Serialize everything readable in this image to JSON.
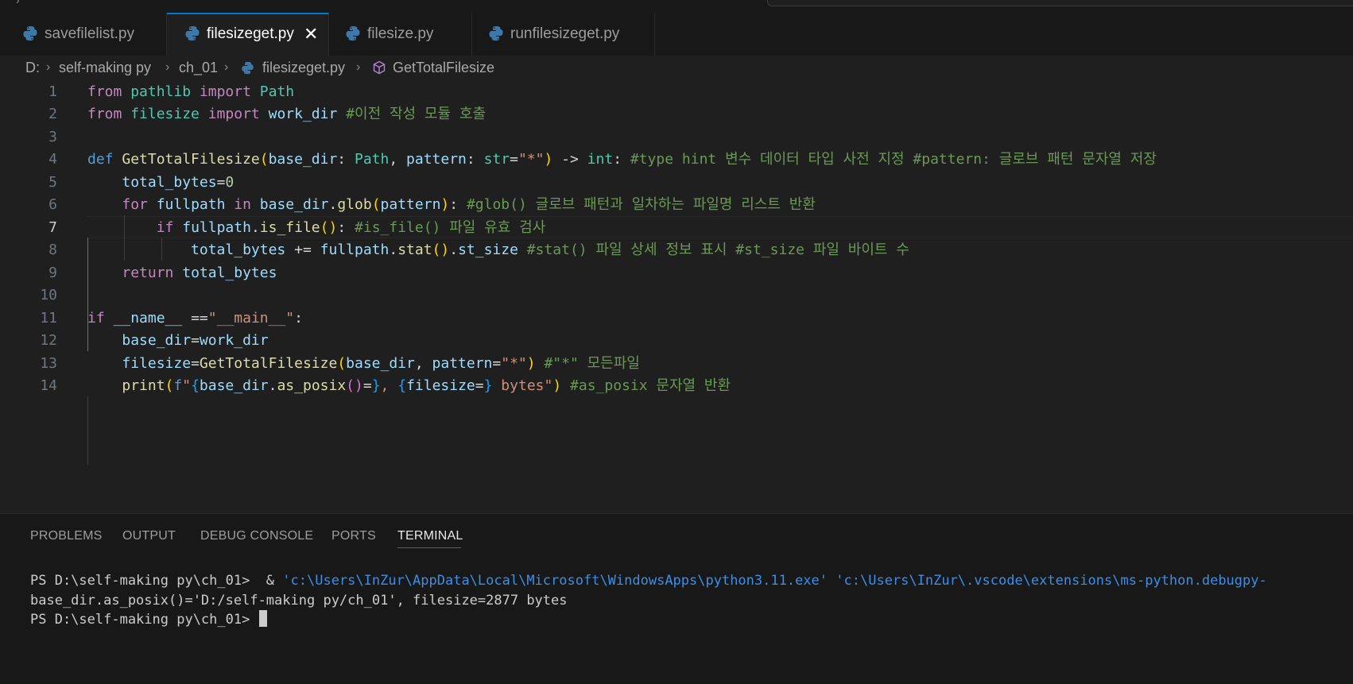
{
  "tabs": [
    {
      "label": "savefilelist.py",
      "active": false
    },
    {
      "label": "filesizeget.py",
      "active": true
    },
    {
      "label": "filesize.py",
      "active": false
    },
    {
      "label": "runfilesizeget.py",
      "active": false
    }
  ],
  "breadcrumb": [
    "D:",
    "self-making py",
    "ch_01",
    "filesizeget.py",
    "GetTotalFilesize"
  ],
  "editor": {
    "line_numbers": [
      "1",
      "2",
      "3",
      "4",
      "5",
      "6",
      "7",
      "8",
      "9",
      "10",
      "11",
      "12",
      "13",
      "14"
    ],
    "current_line": "7",
    "code": {
      "l1": {
        "from": "from",
        "mod": "pathlib",
        "import": "import",
        "name": "Path"
      },
      "l2": {
        "from": "from",
        "mod": "filesize",
        "import": "import",
        "name": "work_dir",
        "comment": "#이전 작성 모듈 호출"
      },
      "l4": {
        "def": "def",
        "fn": "GetTotalFilesize",
        "p1": "base_dir",
        "t1": "Path",
        "p2": "pattern",
        "t2": "str",
        "default": "\"*\"",
        "arrow": "->",
        "ret": "int",
        "comment": "#type hint 변수 데이터 타입 사전 지정 #pattern: 글로브 패턴 문자열 저장"
      },
      "l5": {
        "var": "total_bytes",
        "eq": "=",
        "num": "0"
      },
      "l6": {
        "for": "for",
        "var": "fullpath",
        "in": "in",
        "obj": "base_dir",
        "method": "glob",
        "arg": "pattern",
        "comment": "#glob() 글로브 패턴과 일차하는 파일명 리스트 반환"
      },
      "l7": {
        "if": "if",
        "obj": "fullpath",
        "method": "is_file",
        "comment": "#is_file() 파일 유효 검사"
      },
      "l8": {
        "var": "total_bytes",
        "op": "+=",
        "obj": "fullpath",
        "method": "stat",
        "attr": "st_size",
        "comment": "#stat() 파일 상세 정보 표시 #st_size 파일 바이트 수"
      },
      "l9": {
        "return": "return",
        "var": "total_bytes"
      },
      "l11": {
        "if": "if",
        "name": "__name__",
        "op": "==",
        "str": "\"__main__\""
      },
      "l12": {
        "var": "base_dir",
        "value": "work_dir"
      },
      "l13": {
        "var": "filesize",
        "fn": "GetTotalFilesize",
        "arg": "base_dir",
        "kw": "pattern",
        "str": "\"*\"",
        "comment": "#\"*\" 모든파일"
      },
      "l14": {
        "print": "print",
        "f": "f",
        "q1": "\"",
        "e1": "base_dir",
        "m1": "as_posix",
        "e2": "filesize",
        "tail": " bytes\"",
        "comment": "#as_posix 문자열 반환"
      }
    }
  },
  "panel": {
    "tabs": [
      "PROBLEMS",
      "OUTPUT",
      "DEBUG CONSOLE",
      "PORTS",
      "TERMINAL"
    ],
    "active_tab": "TERMINAL",
    "terminal": {
      "line1_prompt": "PS D:\\self-making py\\ch_01>  & ",
      "line1_path1": "'c:\\Users\\InZur\\AppData\\Local\\Microsoft\\WindowsApps\\python3.11.exe'",
      "line1_path2": "'c:\\Users\\InZur\\.vscode\\extensions\\ms-python.debugpy-",
      "line2": "base_dir.as_posix()='D:/self-making py/ch_01', filesize=2877 bytes",
      "line3": "PS D:\\self-making py\\ch_01> "
    }
  },
  "colors": {
    "accent": "#0078d4",
    "background": "#1f1f1f",
    "keyword": "#c586c0",
    "comment": "#6a9955",
    "string": "#ce9178"
  }
}
